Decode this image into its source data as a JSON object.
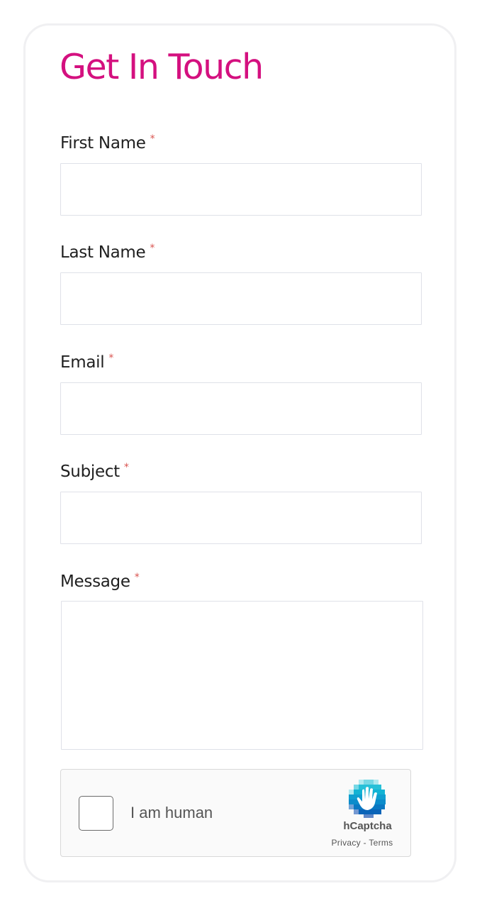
{
  "form": {
    "title": "Get In Touch",
    "required_marker": "*",
    "fields": [
      {
        "label": "First Name",
        "value": "",
        "placeholder": ""
      },
      {
        "label": "Last Name",
        "value": "",
        "placeholder": ""
      },
      {
        "label": "Email",
        "value": "",
        "placeholder": ""
      },
      {
        "label": "Subject",
        "value": "",
        "placeholder": ""
      },
      {
        "label": "Message",
        "value": "",
        "placeholder": ""
      }
    ]
  },
  "captcha": {
    "label": "I am human",
    "brand": "hCaptcha",
    "privacy_link": "Privacy",
    "separator": "-",
    "terms_link": "Terms",
    "checked": false
  },
  "colors": {
    "accent": "#d4107f",
    "required": "#d9534f",
    "field_border": "#dfe1e8"
  },
  "icons": {
    "captcha_logo": "hcaptcha-logo-icon"
  }
}
